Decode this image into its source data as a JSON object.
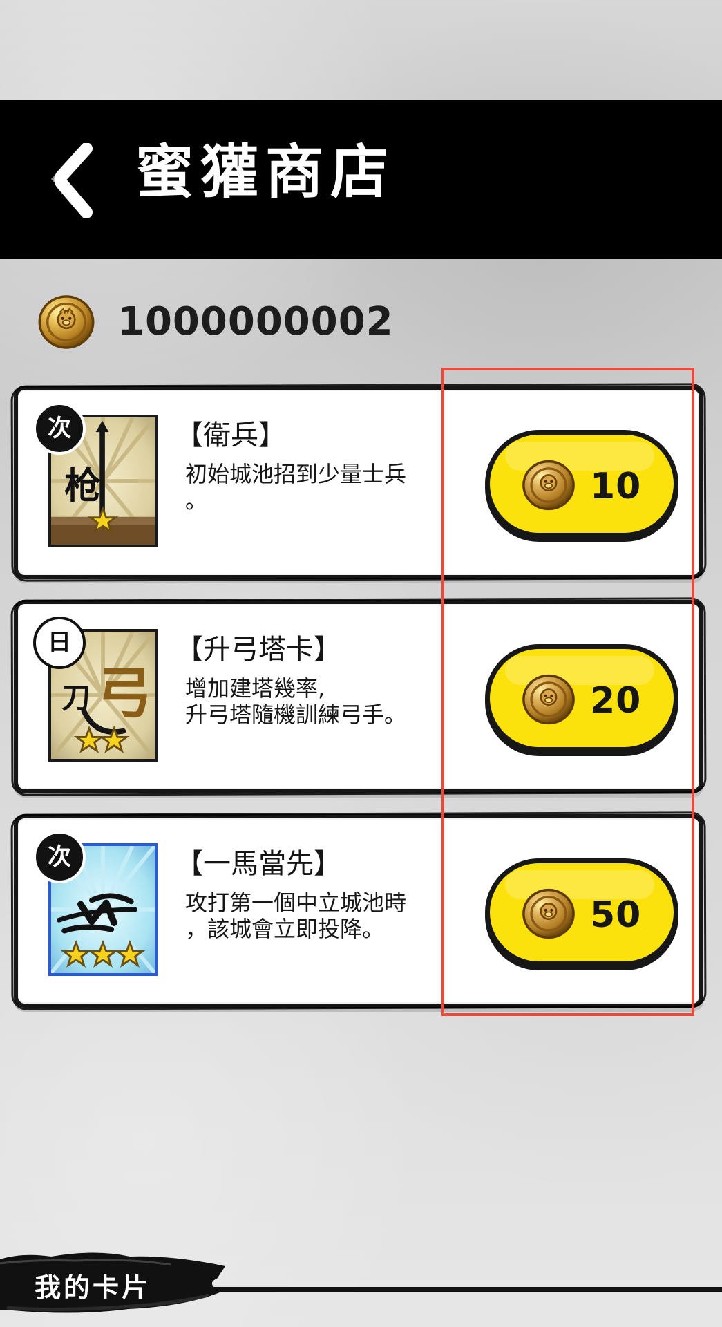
{
  "header": {
    "title": "蜜獾商店"
  },
  "balance": {
    "amount": "1000000002"
  },
  "items": [
    {
      "badge": "次",
      "badge_style": "dark",
      "name": "【衛兵】",
      "description": "初始城池招到少量士兵\n。",
      "price": "10",
      "card_glyph": "枪",
      "stars": 1,
      "card_theme": "parchment"
    },
    {
      "badge": "日",
      "badge_style": "light",
      "name": "【升弓塔卡】",
      "description": "增加建塔幾率,\n升弓塔隨機訓練弓手。",
      "price": "20",
      "card_glyph": "弓",
      "stars": 2,
      "card_theme": "parchment"
    },
    {
      "badge": "次",
      "badge_style": "dark",
      "name": "【一馬當先】",
      "description": "攻打第一個中立城池時\n，該城會立即投降。",
      "price": "50",
      "card_glyph": "骑",
      "stars": 3,
      "card_theme": "blue"
    }
  ],
  "footer": {
    "tab_label": "我的卡片"
  },
  "colors": {
    "header_bg": "#000000",
    "button_yellow": "#fbe20c",
    "highlight_red": "#e74b3b",
    "card_blue": "#4f86d9",
    "coin_gold": "#d1a23a"
  },
  "icons": {
    "back": "chevron-left-icon",
    "coin": "badger-coin-icon",
    "star": "star-icon"
  }
}
